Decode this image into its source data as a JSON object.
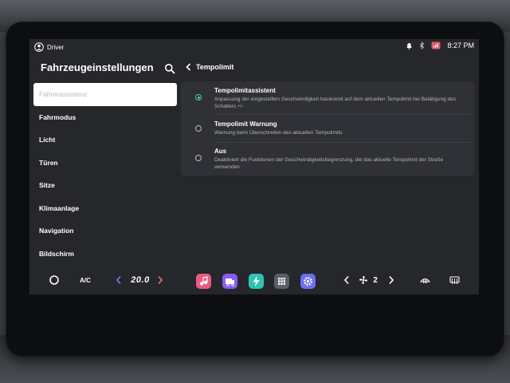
{
  "status": {
    "user": "Driver",
    "time": "8:27 PM",
    "icons": [
      "person-icon",
      "bell-icon",
      "bluetooth-icon",
      "signal-icon"
    ]
  },
  "header": {
    "title": "Fahrzeugeinstellungen",
    "search_icon": "search-icon"
  },
  "sidebar": {
    "items": [
      {
        "label": "Fahrerassistenz",
        "active": true
      },
      {
        "label": "Fahrmodus"
      },
      {
        "label": "Licht"
      },
      {
        "label": "Türen"
      },
      {
        "label": "Sitze"
      },
      {
        "label": "Klimaanlage"
      },
      {
        "label": "Navigation"
      },
      {
        "label": "Bildschirm"
      }
    ]
  },
  "content": {
    "title": "Tempolimit",
    "options": [
      {
        "title": "Tempolimitassistent",
        "desc": "Anpassung der eingestellten Geschwindigkeit basierend auf dem aktuellen Tempolimit bei Betätigung des Schalters +/-",
        "selected": true
      },
      {
        "title": "Tempolimit Warnung",
        "desc": "Warnung beim Überschreiten des aktuellen Tempolimits",
        "selected": false
      },
      {
        "title": "Aus",
        "desc": "Deaktiviert die Funktionen der Geschwindigkeitsbegrenzung, die das aktuelle Tempolimit der Straße verwenden",
        "selected": false
      }
    ]
  },
  "climate": {
    "ac_label": "A/C",
    "temperature": "20.0",
    "fan_level": "2"
  },
  "apps": [
    {
      "icon": "music-icon",
      "color": "#ea5b7f"
    },
    {
      "icon": "vehicle-icon",
      "color": "#8a5cf0"
    },
    {
      "icon": "charging-icon",
      "color": "#2fc3b2"
    },
    {
      "icon": "grid-icon",
      "color": "#5b5f66"
    },
    {
      "icon": "settings-icon",
      "color": "#6a6ff0"
    }
  ],
  "colors": {
    "accent": "#3fd39a",
    "screen_bg": "#26272b",
    "panel_bg": "#303136"
  }
}
